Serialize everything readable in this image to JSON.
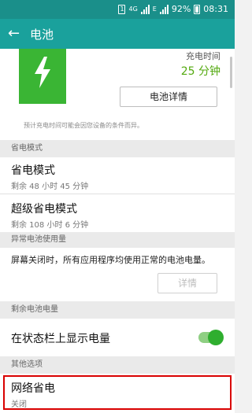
{
  "status_bar": {
    "sim_label": "1",
    "network": "4G",
    "signal2_label": "E",
    "battery_percent": "92%",
    "time": "08:31"
  },
  "app_bar": {
    "back_icon": "back-arrow-icon",
    "title": "电池"
  },
  "battery_card": {
    "icon": "lightning-bolt-icon",
    "charge_label": "充电时间",
    "charge_time": "25 分钟",
    "details_button": "电池详情",
    "note": "预计充电时间可能会因您设备的条件而异。"
  },
  "sections": {
    "power_saving_header": "省电模式",
    "power_saving": {
      "title": "省电模式",
      "subtitle": "剩余 48 小时 45 分钟"
    },
    "ultra_power_saving": {
      "title": "超级省电模式",
      "subtitle": "剩余 108 小时 6 分钟"
    },
    "abnormal_header": "异常电池使用量",
    "abnormal_desc": "屏幕关闭时，所有应用程序均使用正常的电池电量。",
    "abnormal_details_button": "详情",
    "remaining_header": "剩余电池电量",
    "show_in_statusbar": {
      "label": "在状态栏上显示电量",
      "enabled": true
    },
    "other_header": "其他选项",
    "network_saving": {
      "title": "网络省电",
      "subtitle": "关闭"
    }
  },
  "colors": {
    "appbar": "#1aa19c",
    "statusbar": "#1a8f8a",
    "battery_green": "#3ab534",
    "highlight": "#d90000",
    "toggle_on": "#2fae2f"
  }
}
